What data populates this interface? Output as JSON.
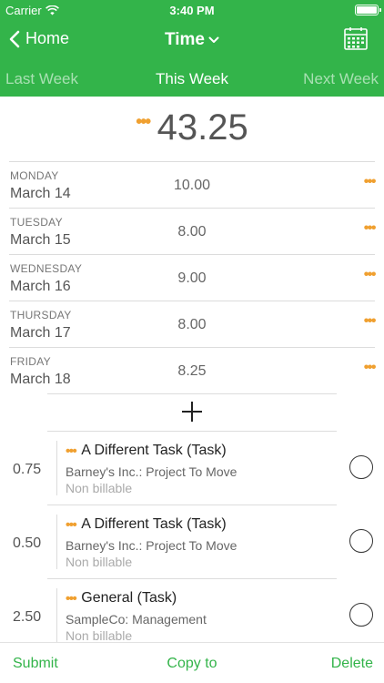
{
  "status_bar": {
    "carrier": "Carrier",
    "time": "3:40 PM"
  },
  "nav": {
    "back_label": "Home",
    "title": "Time"
  },
  "weeks": {
    "last": "Last Week",
    "this": "This Week",
    "next": "Next Week"
  },
  "total": "43.25",
  "days": [
    {
      "dow": "MONDAY",
      "date": "March 14",
      "hours": "10.00"
    },
    {
      "dow": "TUESDAY",
      "date": "March 15",
      "hours": "8.00"
    },
    {
      "dow": "WEDNESDAY",
      "date": "March 16",
      "hours": "9.00"
    },
    {
      "dow": "THURSDAY",
      "date": "March 17",
      "hours": "8.00"
    },
    {
      "dow": "FRIDAY",
      "date": "March 18",
      "hours": "8.25"
    }
  ],
  "tasks": [
    {
      "hours": "0.75",
      "name": "A Different Task (Task)",
      "client": "Barney's Inc.: Project To Move",
      "billing": "Non billable"
    },
    {
      "hours": "0.50",
      "name": "A Different Task (Task)",
      "client": "Barney's Inc.: Project To Move",
      "billing": "Non billable"
    },
    {
      "hours": "2.50",
      "name": "General (Task)",
      "client": "SampleCo: Management",
      "billing": "Non billable"
    }
  ],
  "toolbar": {
    "submit": "Submit",
    "copy": "Copy to",
    "delete": "Delete"
  },
  "colors": {
    "brand_green": "#33b44a",
    "accent_orange": "#f0a030"
  },
  "icons": [
    "wifi-icon",
    "battery-icon",
    "chevron-left-icon",
    "chevron-down-icon",
    "calendar-icon",
    "more-dots-icon",
    "plus-icon",
    "circle-check-icon"
  ]
}
